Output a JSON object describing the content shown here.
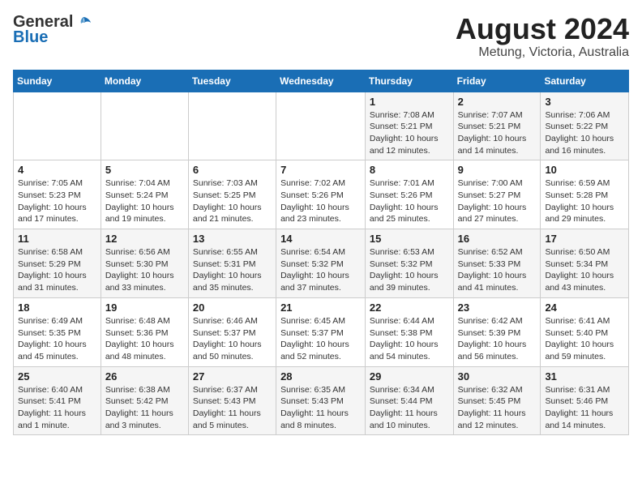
{
  "header": {
    "logo_line1": "General",
    "logo_line2": "Blue",
    "title": "August 2024",
    "subtitle": "Metung, Victoria, Australia"
  },
  "weekdays": [
    "Sunday",
    "Monday",
    "Tuesday",
    "Wednesday",
    "Thursday",
    "Friday",
    "Saturday"
  ],
  "weeks": [
    [
      {
        "day": "",
        "info": ""
      },
      {
        "day": "",
        "info": ""
      },
      {
        "day": "",
        "info": ""
      },
      {
        "day": "",
        "info": ""
      },
      {
        "day": "1",
        "info": "Sunrise: 7:08 AM\nSunset: 5:21 PM\nDaylight: 10 hours\nand 12 minutes."
      },
      {
        "day": "2",
        "info": "Sunrise: 7:07 AM\nSunset: 5:21 PM\nDaylight: 10 hours\nand 14 minutes."
      },
      {
        "day": "3",
        "info": "Sunrise: 7:06 AM\nSunset: 5:22 PM\nDaylight: 10 hours\nand 16 minutes."
      }
    ],
    [
      {
        "day": "4",
        "info": "Sunrise: 7:05 AM\nSunset: 5:23 PM\nDaylight: 10 hours\nand 17 minutes."
      },
      {
        "day": "5",
        "info": "Sunrise: 7:04 AM\nSunset: 5:24 PM\nDaylight: 10 hours\nand 19 minutes."
      },
      {
        "day": "6",
        "info": "Sunrise: 7:03 AM\nSunset: 5:25 PM\nDaylight: 10 hours\nand 21 minutes."
      },
      {
        "day": "7",
        "info": "Sunrise: 7:02 AM\nSunset: 5:26 PM\nDaylight: 10 hours\nand 23 minutes."
      },
      {
        "day": "8",
        "info": "Sunrise: 7:01 AM\nSunset: 5:26 PM\nDaylight: 10 hours\nand 25 minutes."
      },
      {
        "day": "9",
        "info": "Sunrise: 7:00 AM\nSunset: 5:27 PM\nDaylight: 10 hours\nand 27 minutes."
      },
      {
        "day": "10",
        "info": "Sunrise: 6:59 AM\nSunset: 5:28 PM\nDaylight: 10 hours\nand 29 minutes."
      }
    ],
    [
      {
        "day": "11",
        "info": "Sunrise: 6:58 AM\nSunset: 5:29 PM\nDaylight: 10 hours\nand 31 minutes."
      },
      {
        "day": "12",
        "info": "Sunrise: 6:56 AM\nSunset: 5:30 PM\nDaylight: 10 hours\nand 33 minutes."
      },
      {
        "day": "13",
        "info": "Sunrise: 6:55 AM\nSunset: 5:31 PM\nDaylight: 10 hours\nand 35 minutes."
      },
      {
        "day": "14",
        "info": "Sunrise: 6:54 AM\nSunset: 5:32 PM\nDaylight: 10 hours\nand 37 minutes."
      },
      {
        "day": "15",
        "info": "Sunrise: 6:53 AM\nSunset: 5:32 PM\nDaylight: 10 hours\nand 39 minutes."
      },
      {
        "day": "16",
        "info": "Sunrise: 6:52 AM\nSunset: 5:33 PM\nDaylight: 10 hours\nand 41 minutes."
      },
      {
        "day": "17",
        "info": "Sunrise: 6:50 AM\nSunset: 5:34 PM\nDaylight: 10 hours\nand 43 minutes."
      }
    ],
    [
      {
        "day": "18",
        "info": "Sunrise: 6:49 AM\nSunset: 5:35 PM\nDaylight: 10 hours\nand 45 minutes."
      },
      {
        "day": "19",
        "info": "Sunrise: 6:48 AM\nSunset: 5:36 PM\nDaylight: 10 hours\nand 48 minutes."
      },
      {
        "day": "20",
        "info": "Sunrise: 6:46 AM\nSunset: 5:37 PM\nDaylight: 10 hours\nand 50 minutes."
      },
      {
        "day": "21",
        "info": "Sunrise: 6:45 AM\nSunset: 5:37 PM\nDaylight: 10 hours\nand 52 minutes."
      },
      {
        "day": "22",
        "info": "Sunrise: 6:44 AM\nSunset: 5:38 PM\nDaylight: 10 hours\nand 54 minutes."
      },
      {
        "day": "23",
        "info": "Sunrise: 6:42 AM\nSunset: 5:39 PM\nDaylight: 10 hours\nand 56 minutes."
      },
      {
        "day": "24",
        "info": "Sunrise: 6:41 AM\nSunset: 5:40 PM\nDaylight: 10 hours\nand 59 minutes."
      }
    ],
    [
      {
        "day": "25",
        "info": "Sunrise: 6:40 AM\nSunset: 5:41 PM\nDaylight: 11 hours\nand 1 minute."
      },
      {
        "day": "26",
        "info": "Sunrise: 6:38 AM\nSunset: 5:42 PM\nDaylight: 11 hours\nand 3 minutes."
      },
      {
        "day": "27",
        "info": "Sunrise: 6:37 AM\nSunset: 5:43 PM\nDaylight: 11 hours\nand 5 minutes."
      },
      {
        "day": "28",
        "info": "Sunrise: 6:35 AM\nSunset: 5:43 PM\nDaylight: 11 hours\nand 8 minutes."
      },
      {
        "day": "29",
        "info": "Sunrise: 6:34 AM\nSunset: 5:44 PM\nDaylight: 11 hours\nand 10 minutes."
      },
      {
        "day": "30",
        "info": "Sunrise: 6:32 AM\nSunset: 5:45 PM\nDaylight: 11 hours\nand 12 minutes."
      },
      {
        "day": "31",
        "info": "Sunrise: 6:31 AM\nSunset: 5:46 PM\nDaylight: 11 hours\nand 14 minutes."
      }
    ]
  ]
}
